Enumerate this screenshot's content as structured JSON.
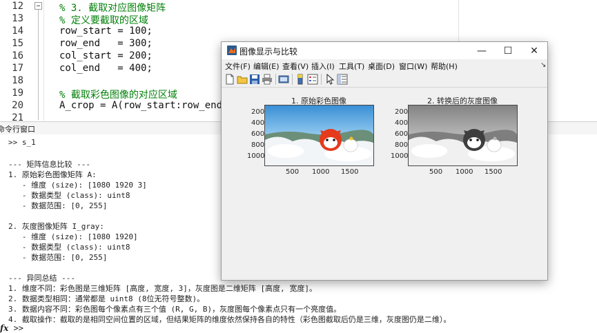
{
  "editor": {
    "lines": [
      {
        "num": "12",
        "text": "% 3. 截取对应图像矩阵",
        "comment": true
      },
      {
        "num": "13",
        "text": "% 定义要截取的区域",
        "comment": true
      },
      {
        "num": "14",
        "text": "row_start = 100;",
        "comment": false
      },
      {
        "num": "15",
        "text": "row_end   = 300;",
        "comment": false
      },
      {
        "num": "16",
        "text": "col_start = 200;",
        "comment": false
      },
      {
        "num": "17",
        "text": "col_end   = 400;",
        "comment": false
      },
      {
        "num": "18",
        "text": "",
        "comment": false
      },
      {
        "num": "19",
        "text": "% 截取彩色图像的对应区域",
        "comment": true
      },
      {
        "num": "20",
        "text": "A_crop = A(row_start:row_end, c",
        "comment": false
      },
      {
        "num": "21",
        "text": "",
        "comment": false
      }
    ]
  },
  "command_window": {
    "title": "命令行窗口",
    "lines": [
      ">> s_1",
      "",
      "--- 矩阵信息比较 ---",
      "1. 原始彩色图像矩阵 A:",
      "   - 维度 (size): [1080 1920 3]",
      "   - 数据类型 (class): uint8",
      "   - 数据范围: [0, 255]",
      "",
      "2. 灰度图像矩阵 I_gray:",
      "   - 维度 (size): [1080 1920]",
      "   - 数据类型 (class): uint8",
      "   - 数据范围: [0, 255]",
      "",
      "--- 异同总结 ---",
      "1. 维度不同：彩色图是三维矩阵 [高度, 宽度, 3]，灰度图是二维矩阵 [高度, 宽度]。",
      "2. 数据类型相同：通常都是 uint8 (8位无符号整数)。",
      "3. 数据内容不同：彩色图每个像素点有三个值 (R, G, B)，灰度图每个像素点只有一个亮度值。",
      "4. 截取操作：截取的是相同空间位置的区域，但结果矩阵的维度依然保持各自的特性（彩色图截取后仍是三维，灰度图仍是二维）。"
    ],
    "prompt_fx": "fx",
    "prompt": ">>"
  },
  "figure": {
    "title": "图像显示与比较",
    "window_buttons": {
      "minimize": "—",
      "maximize": "☐",
      "close": "✕"
    },
    "menus": [
      "文件(F)",
      "编辑(E)",
      "查看(V)",
      "插入(I)",
      "工具(T)",
      "桌面(D)",
      "窗口(W)",
      "帮助(H)"
    ],
    "dock_arrow": "↘",
    "toolbar_icons": [
      "new-figure-icon",
      "open-file-icon",
      "save-icon",
      "print-icon",
      "print-preview-icon",
      "colorbar-icon",
      "legend-icon",
      "pointer-icon",
      "property-inspector-icon"
    ],
    "axes": [
      {
        "title": "1. 原始彩色图像",
        "image": "color",
        "yticks": [
          "200",
          "400",
          "600",
          "800",
          "1000"
        ],
        "xticks": [
          "500",
          "1000",
          "1500"
        ]
      },
      {
        "title": "2. 转换后的灰度图像",
        "image": "gray",
        "yticks": [
          "200",
          "400",
          "600",
          "800",
          "1000"
        ],
        "xticks": [
          "500",
          "1000",
          "1500"
        ]
      }
    ]
  }
}
